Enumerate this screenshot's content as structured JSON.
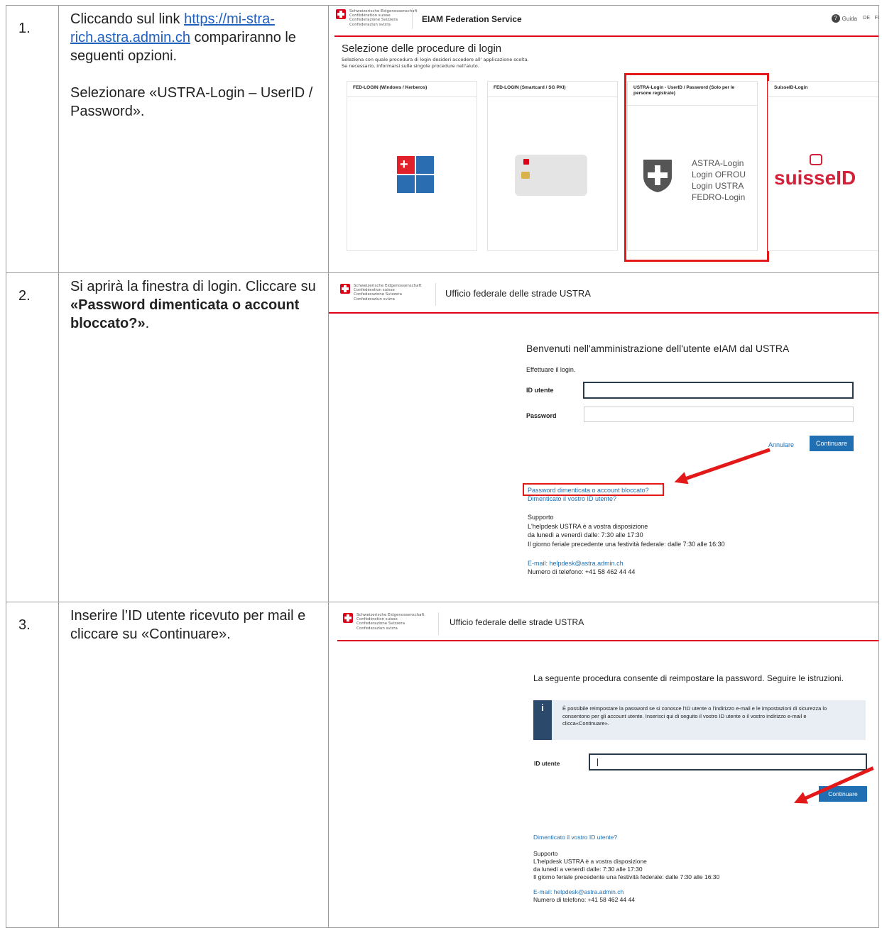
{
  "steps": [
    {
      "num": "1.",
      "link": "https://mi-stra-rich.astra.admin.ch",
      "text_pre": "Cliccando sul link ",
      "text_post": " compariranno le seguenti opzioni.",
      "text2": "Selezionare «USTRA-Login – UserID / Password»."
    },
    {
      "num": "2.",
      "text_pre": "Si aprirà la finestra di login. Cliccare su ",
      "bold": "«Password dimenticata o account bloccato?»",
      "text_post": "."
    },
    {
      "num": "3.",
      "text": "Inserire l’ID utente ricevuto per mail e cliccare su «Continuare»."
    }
  ],
  "federal": [
    "Schweizerische Eidgenossenschaft",
    "Confédération suisse",
    "Confederazione Svizzera",
    "Confederaziun svizra"
  ],
  "shot1": {
    "title": "EIAM Federation Service",
    "help": "Guida",
    "langs": [
      "DE",
      "FR"
    ],
    "heading": "Selezione delle procedure di login",
    "sub1": "Seleziona con quale procedura di login desideri accedere all' applicazione scelta.",
    "sub2": "Se necessario, informarsi sulle singole procedure nell'aiuto.",
    "cards": [
      "FED-LOGIN (Windows / Kerberos)",
      "FED-LOGIN (Smartcard / SG PKI)",
      "USTRA-Login - UserID / Password (Solo per le persone registrate)",
      "SuisseID-Login"
    ],
    "astra_lines": [
      "ASTRA-Login",
      "Login OFROU",
      "Login USTRA",
      "FEDRO-Login"
    ],
    "suisseid": "suisseID"
  },
  "shot2": {
    "title": "Ufficio federale delle strade USTRA",
    "welcome": "Benvenuti nell'amministrazione dell'utente eIAM dal USTRA",
    "login_prompt": "Effettuare il login.",
    "userid_label": "ID utente",
    "password_label": "Password",
    "cancel": "Annulare",
    "continue": "Continuare",
    "forgot_pw": "Password dimenticata o account bloccato?",
    "forgot_id": "Dimenticato il vostro ID utente?",
    "support": [
      "Supporto",
      "L'helpdesk USTRA è a vostra disposizione",
      "da lunedì a venerdì dalle: 7:30 alle 17:30",
      "Il giorno feriale precedente una festività federale: dalle 7:30 alle 16:30"
    ],
    "email": "E-mail: helpdesk@astra.admin.ch",
    "phone": "Numero di telefono: +41 58 462 44 44"
  },
  "shot3": {
    "title": "Ufficio federale delle strade USTRA",
    "intro": "La seguente procedura consente di reimpostare la password. Seguire le istruzioni.",
    "info": "È possibile reimpostare la password se si conosce l'ID utente o l'indirizzo e-mail e le impostazioni di sicurezza lo consentono per gli account utente. Inserisci qui di seguito il vostro ID utente o il vostro indirizzo e-mail e clicca«Continuare».",
    "userid_label": "ID utente",
    "continue": "Continuare",
    "forgot_id": "Dimenticato il vostro ID utente?",
    "support": [
      "Supporto",
      "L'helpdesk USTRA è a vostra disposizione",
      "da lunedì a venerdì dalle: 7:30 alle 17:30",
      "Il giorno feriale precedente una festività federale: dalle 7:30 alle 16:30"
    ],
    "email": "E-mail: helpdesk@astra.admin.ch",
    "phone": "Numero di telefono: +41 58 462 44 44"
  },
  "colors": {
    "swiss_red": "#dc0018",
    "link_blue": "#1f6fb2",
    "highlight_red": "#e31818"
  }
}
